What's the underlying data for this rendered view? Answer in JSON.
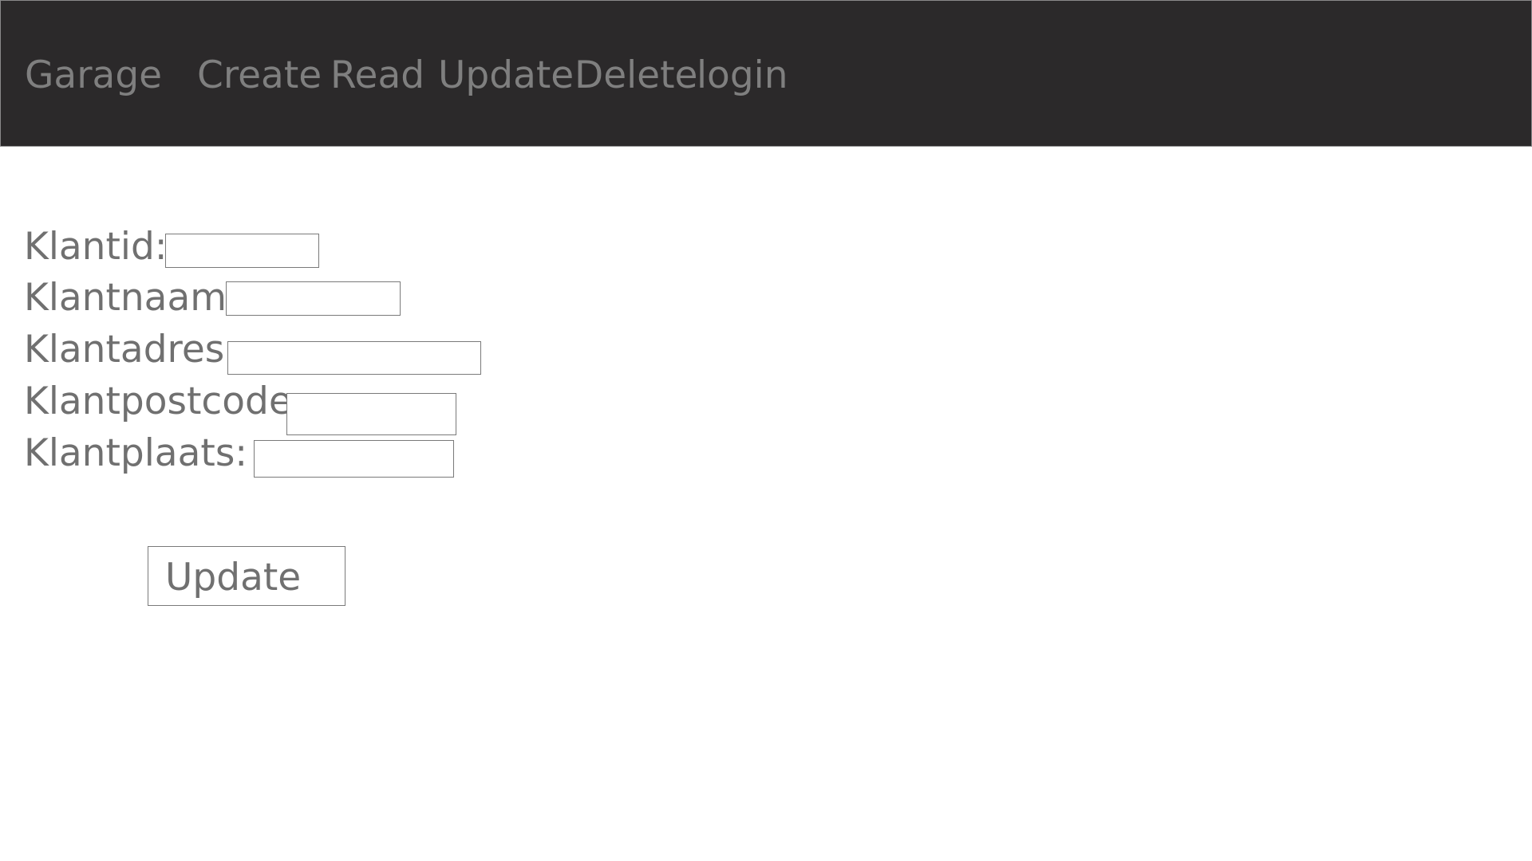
{
  "navbar": {
    "brand": "Garage",
    "items": [
      "Create",
      "Read",
      "Update",
      "Delete",
      "login"
    ]
  },
  "form": {
    "fields": [
      {
        "label": "Klantid:",
        "value": ""
      },
      {
        "label": "Klantnaam:",
        "value": ""
      },
      {
        "label": "Klantadres:",
        "value": ""
      },
      {
        "label": "Klantpostcode:",
        "value": ""
      },
      {
        "label": "Klantplaats:",
        "value": ""
      }
    ],
    "submit_label": "Update"
  },
  "colors": {
    "navbar_background": "#2b292a",
    "nav_text": "#7f7f7f",
    "body_text": "#707070",
    "border": "#7a7a7a"
  }
}
